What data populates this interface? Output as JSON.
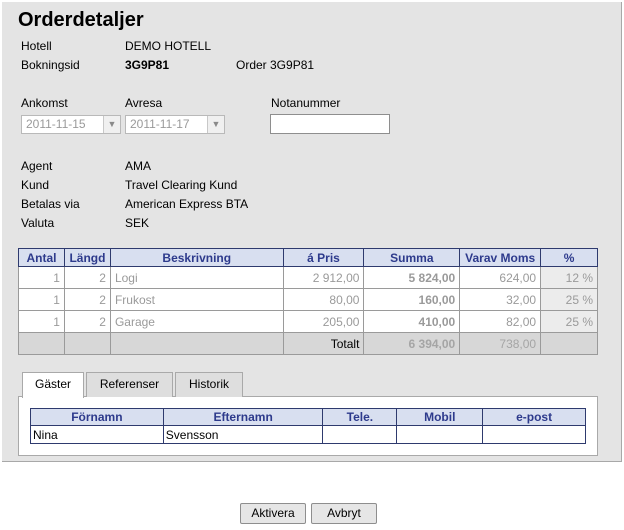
{
  "header": {
    "title": "Orderdetaljer"
  },
  "info": {
    "hotel_label": "Hotell",
    "hotel_value": "DEMO HOTELL",
    "booking_label": "Bokningsid",
    "booking_value": "3G9P81",
    "order_text": "Order 3G9P81"
  },
  "dates": {
    "arrival_label": "Ankomst",
    "arrival_value": "2011-11-15",
    "departure_label": "Avresa",
    "departure_value": "2011-11-17",
    "note_label": "Notanummer",
    "note_value": ""
  },
  "details": {
    "agent_label": "Agent",
    "agent_value": "AMA",
    "customer_label": "Kund",
    "customer_value": "Travel Clearing Kund",
    "payment_label": "Betalas via",
    "payment_value": "American Express BTA",
    "currency_label": "Valuta",
    "currency_value": "SEK"
  },
  "order_table": {
    "headers": [
      "Antal",
      "Längd",
      "Beskrivning",
      "á Pris",
      "Summa",
      "Varav Moms",
      "%"
    ],
    "rows": [
      {
        "antal": "1",
        "langd": "2",
        "beskrivning": "Logi",
        "pris": "2 912,00",
        "summa": "5 824,00",
        "moms": "624,00",
        "procent": "12 %"
      },
      {
        "antal": "1",
        "langd": "2",
        "beskrivning": "Frukost",
        "pris": "80,00",
        "summa": "160,00",
        "moms": "32,00",
        "procent": "25 %"
      },
      {
        "antal": "1",
        "langd": "2",
        "beskrivning": "Garage",
        "pris": "205,00",
        "summa": "410,00",
        "moms": "82,00",
        "procent": "25 %"
      }
    ],
    "total_label": "Totalt",
    "total_summa": "6 394,00",
    "total_moms": "738,00"
  },
  "tabs": [
    {
      "label": "Gäster"
    },
    {
      "label": "Referenser"
    },
    {
      "label": "Historik"
    }
  ],
  "guests": {
    "headers": [
      "Förnamn",
      "Efternamn",
      "Tele.",
      "Mobil",
      "e-post"
    ],
    "rows": [
      {
        "fornamn": "Nina",
        "efternamn": "Svensson",
        "tele": "",
        "mobil": "",
        "epost": ""
      }
    ]
  },
  "buttons": {
    "activate": "Aktivera",
    "cancel": "Avbryt"
  }
}
